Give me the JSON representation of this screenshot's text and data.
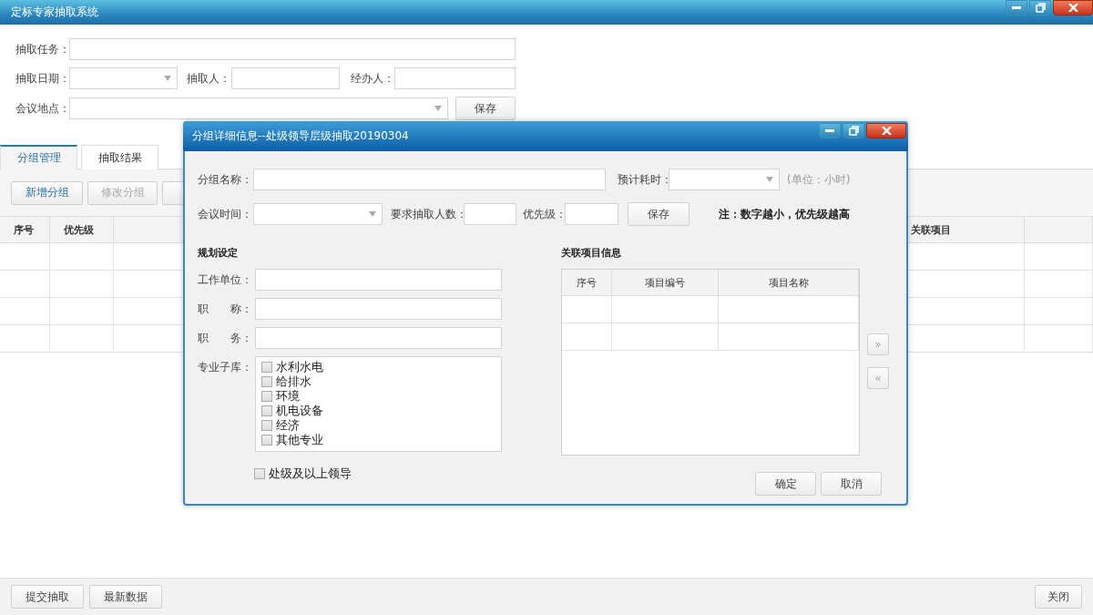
{
  "window": {
    "title": "定标专家抽取系统"
  },
  "task_form": {
    "task_label": "抽取任务：",
    "date_label": "抽取日期：",
    "drawer_label": "抽取人：",
    "handler_label": "经办人：",
    "location_label": "会议地点：",
    "save_button": "保存"
  },
  "tabs": [
    {
      "label": "分组管理",
      "selected": true
    },
    {
      "label": "抽取结果",
      "selected": false
    }
  ],
  "toolbar": [
    {
      "label": "新增分组",
      "disabled": false
    },
    {
      "label": "修改分组",
      "disabled": true
    }
  ],
  "table": {
    "columns": [
      "序号",
      "优先级",
      "关联项目"
    ]
  },
  "footer": {
    "left_buttons": [
      "提交抽取",
      "最新数据"
    ],
    "right_buttons": [
      "关闭"
    ]
  },
  "dialog": {
    "title": "分组详细信息--处级领导层级抽取20190304",
    "group_name_label": "分组名称：",
    "duration_label": "预计耗时：",
    "duration_unit": "(单位：小时)",
    "meeting_time_label": "会议时间：",
    "count_label": "要求抽取人数：",
    "priority_label": "优先级：",
    "save_button": "保存",
    "note": "注：数字越小，优先级越高",
    "plan": {
      "heading": "规划设定",
      "fields": [
        "工作单位：",
        "职　　称：",
        "职　　务："
      ],
      "library_label": "专业子库：",
      "libraries": [
        {
          "label": "水利水电",
          "checked": false
        },
        {
          "label": "给排水",
          "checked": false
        },
        {
          "label": "环境",
          "checked": false
        },
        {
          "label": "机电设备",
          "checked": false
        },
        {
          "label": "经济",
          "checked": false
        },
        {
          "label": "其他专业",
          "checked": false
        }
      ]
    },
    "leader_option": {
      "label": "处级及以上领导",
      "checked": false
    },
    "projects": {
      "heading": "关联项目信息",
      "columns": [
        "序号",
        "项目编号",
        "项目名称"
      ]
    },
    "move_buttons": [
      {
        "label": "»",
        "disabled": true
      },
      {
        "label": "«",
        "disabled": true
      }
    ],
    "buttons": [
      "确定",
      "取消"
    ]
  }
}
